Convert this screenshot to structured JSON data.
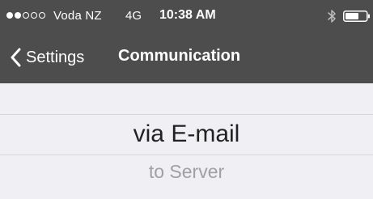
{
  "statusbar": {
    "signal_dots": [
      true,
      true,
      false,
      false,
      false
    ],
    "carrier": "Voda NZ",
    "network": "4G",
    "time": "10:38 AM",
    "icons": [
      "bluetooth-icon",
      "battery-icon"
    ]
  },
  "navbar": {
    "back_label": "Settings",
    "title": "Communication"
  },
  "picker": {
    "options": [
      "via E-mail",
      "to Server"
    ],
    "selected_index": 0
  },
  "colors": {
    "navbar_bg": "#4d4d4d",
    "content_bg": "#efeff4",
    "selected_text": "#222222",
    "unselected_text": "#a0a0a4"
  }
}
